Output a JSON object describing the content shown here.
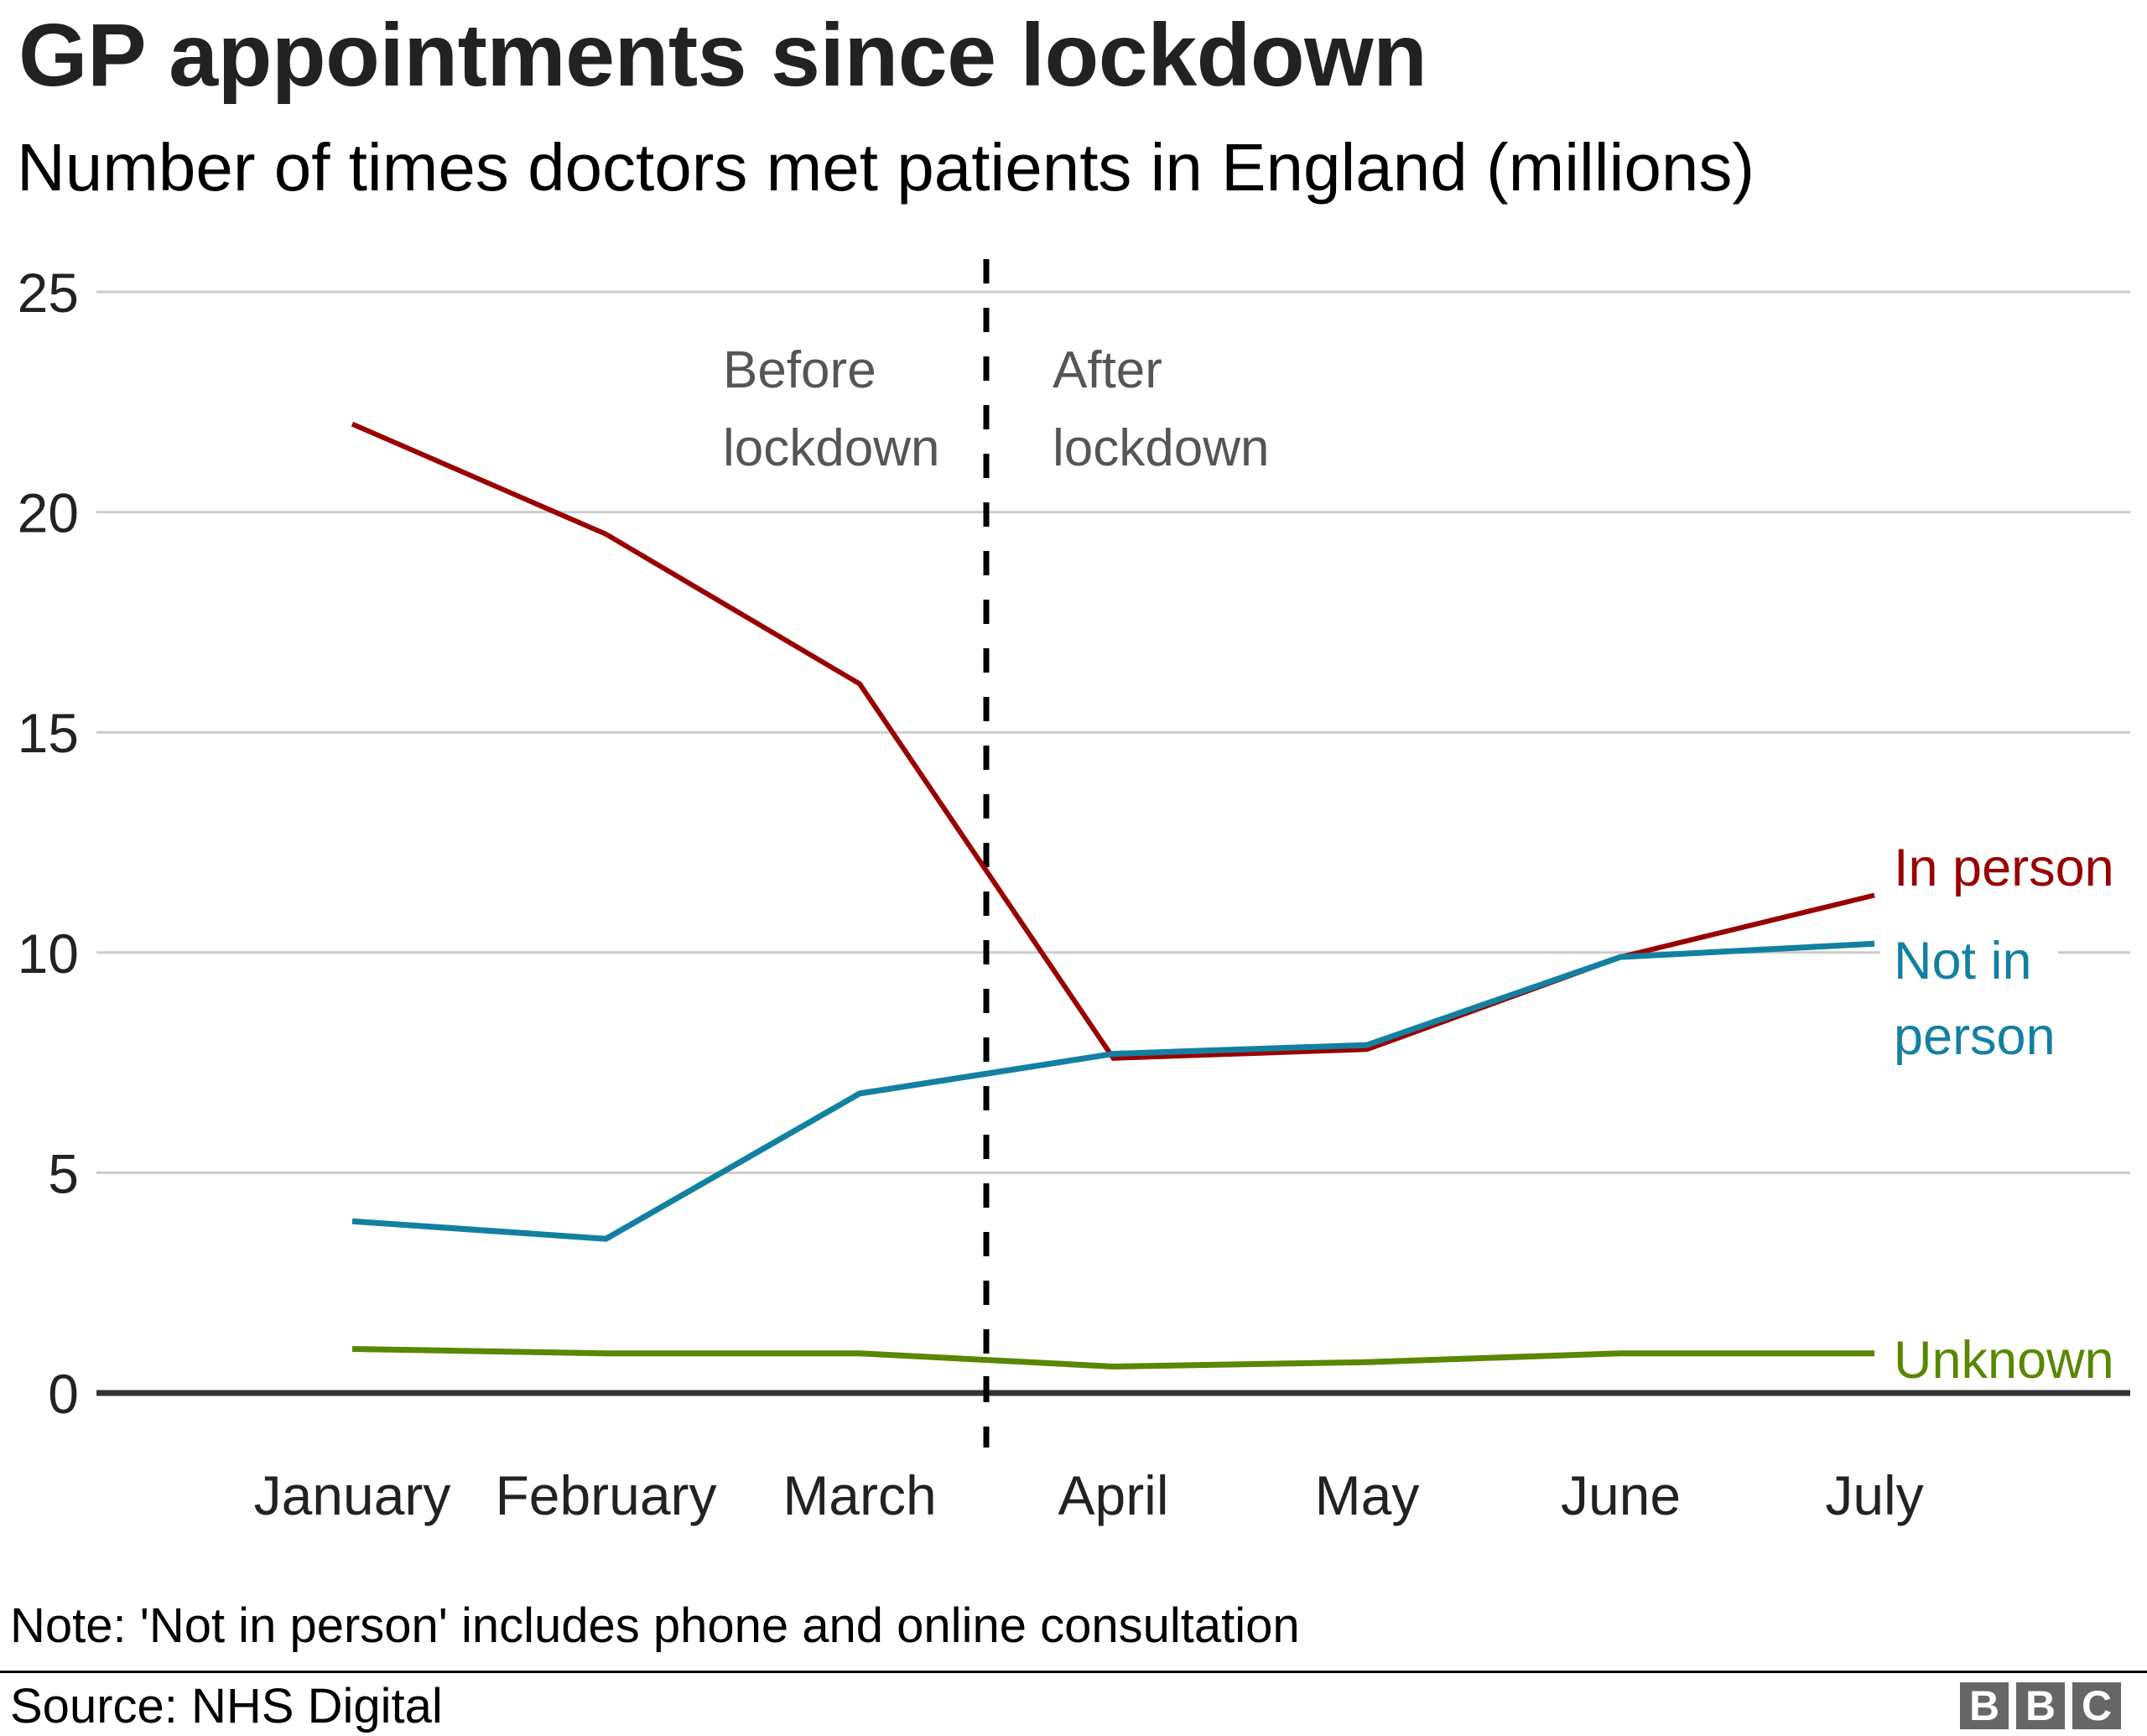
{
  "header": {
    "title": "GP appointments since lockdown",
    "subtitle": "Number of times doctors met patients in England (millions)"
  },
  "footer": {
    "note": "Note: 'Not in person' includes phone and online consultation",
    "source": "Source: NHS Digital",
    "logo_letters": [
      "B",
      "B",
      "C"
    ]
  },
  "colors": {
    "in_person": "#990000",
    "not_in_person": "#1380A1",
    "unknown": "#588700",
    "gridline": "#cccccc",
    "baseline": "#333333",
    "annotation": "#555555",
    "divider": "#000000",
    "logo": "#666666"
  },
  "chart_data": {
    "type": "line",
    "title": "GP appointments since lockdown",
    "subtitle": "Number of times doctors met patients in England (millions)",
    "xlabel": "",
    "ylabel": "",
    "categories": [
      "January",
      "February",
      "March",
      "April",
      "May",
      "June",
      "July"
    ],
    "ylim": [
      0,
      25
    ],
    "yticks": [
      0,
      5,
      10,
      15,
      20,
      25
    ],
    "ytick_labels": [
      "0",
      "5",
      "10",
      "15",
      "20",
      "25"
    ],
    "grid": true,
    "legend": "right, direct labels at line ends",
    "series": [
      {
        "name": "In person",
        "label": "In person",
        "color": "#990000",
        "values": [
          22.0,
          19.5,
          16.1,
          7.6,
          7.8,
          9.9,
          11.3
        ]
      },
      {
        "name": "Not in person",
        "label_lines": [
          "Not in",
          "person"
        ],
        "color": "#1380A1",
        "values": [
          3.9,
          3.5,
          6.8,
          7.7,
          7.9,
          9.9,
          10.2
        ]
      },
      {
        "name": "Unknown",
        "label": "Unknown",
        "color": "#588700",
        "values": [
          1.0,
          0.9,
          0.9,
          0.6,
          0.7,
          0.9,
          0.9
        ]
      }
    ],
    "annotations": [
      {
        "type": "vertical-dashed-line",
        "position": "between March and April",
        "label": "Lockdown"
      },
      {
        "text_lines": [
          "Before",
          "lockdown"
        ],
        "side": "left of divider"
      },
      {
        "text_lines": [
          "After",
          "lockdown"
        ],
        "side": "right of divider"
      }
    ]
  }
}
